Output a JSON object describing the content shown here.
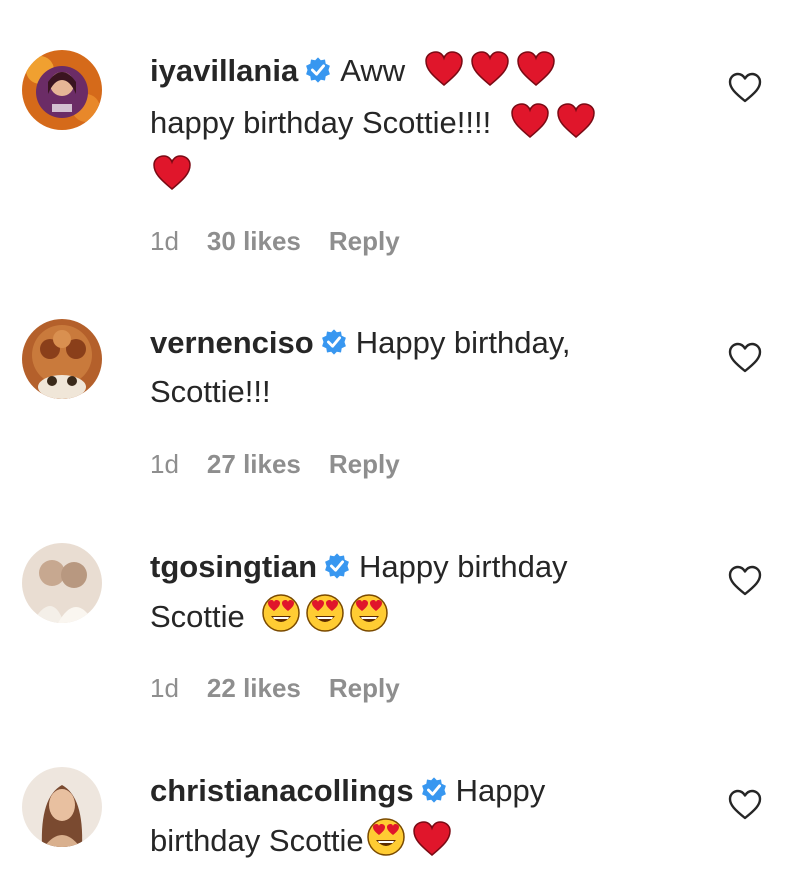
{
  "comments": [
    {
      "username": "iyavillania",
      "verified": true,
      "text_line1": "Aww",
      "text_line2": "happy birthday Scottie!!!!",
      "emoji_line1": [
        "red-heart",
        "red-heart",
        "red-heart"
      ],
      "emoji_line2": [
        "red-heart",
        "red-heart"
      ],
      "emoji_line3": [
        "red-heart"
      ],
      "time": "1d",
      "likes": "30 likes",
      "reply": "Reply",
      "avatar_color": "#7a2a3a"
    },
    {
      "username": "vernenciso",
      "verified": true,
      "text_line1": "Happy birthday,",
      "text_line2": "Scottie!!!",
      "time": "1d",
      "likes": "27 likes",
      "reply": "Reply",
      "avatar_color": "#a3552a"
    },
    {
      "username": "tgosingtian",
      "verified": true,
      "text_line1": "Happy birthday",
      "text_line2": "Scottie",
      "emoji_line2": [
        "heart-eyes-face",
        "heart-eyes-face",
        "heart-eyes-face"
      ],
      "time": "1d",
      "likes": "22 likes",
      "reply": "Reply",
      "avatar_color": "#d8c6b8"
    },
    {
      "username": "christianacollings",
      "verified": true,
      "text_line1": "Happy",
      "text_line2": "birthday Scottie",
      "emoji_line2": [
        "heart-eyes-face",
        "red-heart"
      ],
      "avatar_color": "#c9a58c"
    }
  ],
  "colors": {
    "verified_blue": "#3897f0",
    "heart_red": "#e0162b",
    "meta_gray": "#8e8e8e",
    "text": "#262626"
  }
}
